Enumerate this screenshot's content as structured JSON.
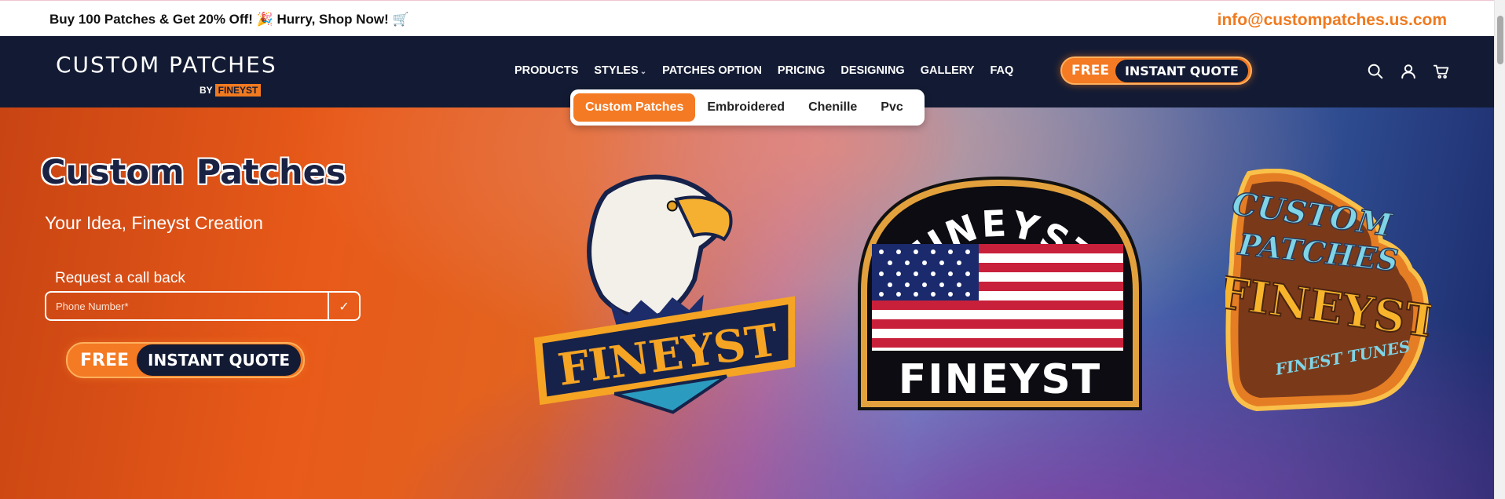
{
  "topbar": {
    "promo": "Buy 100 Patches & Get 20% Off! 🎉 Hurry, Shop Now! 🛒",
    "email": "info@custompatches.us.com"
  },
  "header": {
    "logo_main": "CUSTOM PATCHES",
    "logo_by": "BY",
    "logo_brand": "FINEYST",
    "nav": [
      {
        "label": "PRODUCTS"
      },
      {
        "label": "STYLES"
      },
      {
        "label": "PATCHES OPTION"
      },
      {
        "label": "PRICING"
      },
      {
        "label": "DESIGNING"
      },
      {
        "label": "GALLERY"
      },
      {
        "label": "FAQ"
      }
    ],
    "quote_free": "FREE",
    "quote_instant": "INSTANT QUOTE",
    "icons": [
      "search-icon",
      "user-icon",
      "cart-icon"
    ]
  },
  "dropdown": {
    "items": [
      {
        "label": "Custom Patches"
      },
      {
        "label": "Embroidered"
      },
      {
        "label": "Chenille"
      },
      {
        "label": "Pvc"
      }
    ],
    "active": "Custom Patches"
  },
  "hero": {
    "title": "Custom Patches",
    "subtitle": "Your Idea, Fineyst Creation",
    "callback_label": "Request a call back",
    "phone_placeholder": "Phone Number*",
    "submit_glyph": "✓",
    "quote_free": "FREE",
    "quote_instant": "INSTANT QUOTE",
    "patches": {
      "eagle_text": "FINEYST",
      "flag_top_text": "FINEYST",
      "flag_bottom_text": "FINEYST",
      "retro_line1": "CUSTOM",
      "retro_line2": "PATCHES",
      "retro_line3": "FINEYST",
      "retro_line4": "FINEST TUNES"
    }
  },
  "colors": {
    "accent": "#f47a23",
    "navy": "#131b34",
    "email": "#f07a1f"
  }
}
